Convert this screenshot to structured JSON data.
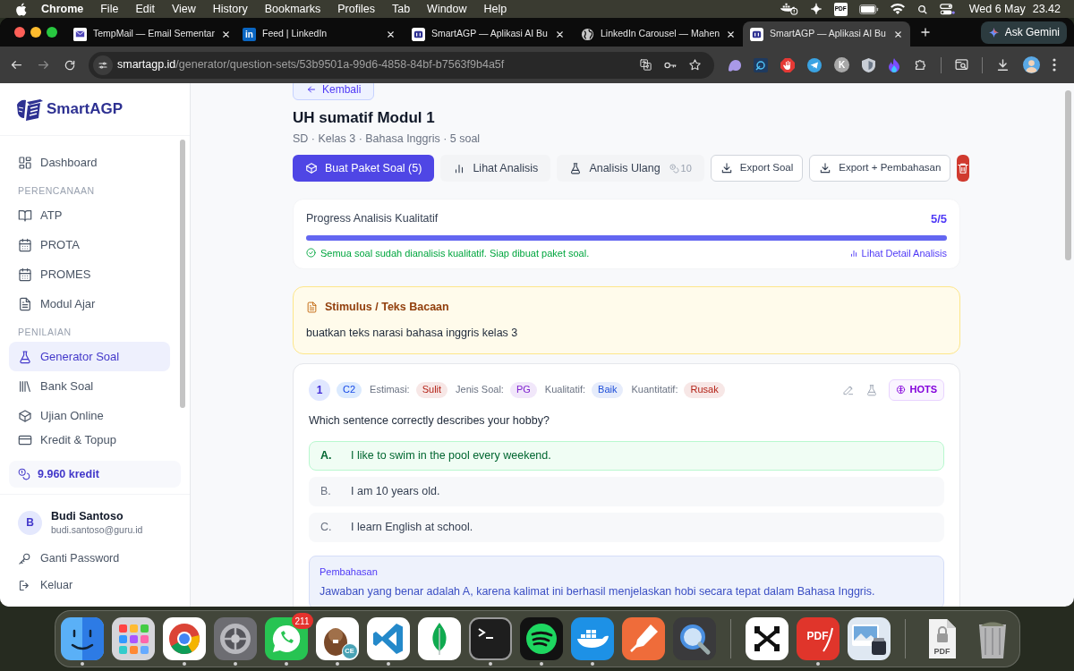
{
  "menubar": {
    "app": "Chrome",
    "menus": [
      "File",
      "Edit",
      "View",
      "History",
      "Bookmarks",
      "Profiles",
      "Tab",
      "Window",
      "Help"
    ],
    "pdf_icon_label": "PDF",
    "date": "Wed 6 May",
    "time": "23.42"
  },
  "browser": {
    "tabs": [
      {
        "title": "TempMail — Email Sementar",
        "selected": false
      },
      {
        "title": "Feed | LinkedIn",
        "selected": false,
        "favicon_label": "in"
      },
      {
        "title": "SmartAGP — Aplikasi AI Bu",
        "selected": false
      },
      {
        "title": "LinkedIn Carousel — Mahen",
        "selected": false
      },
      {
        "title": "SmartAGP — Aplikasi AI Bu",
        "selected": true
      }
    ],
    "gemini_button": "Ask Gemini",
    "url_host": "smartagp.id",
    "url_path": "/generator/question-sets/53b9501a-99d6-4858-84bf-b7563f9b4a5f",
    "extension_letter": "K"
  },
  "sidebar": {
    "brand": "SmartAGP",
    "items": [
      {
        "kind": "link",
        "label": "Dashboard",
        "selected": false
      },
      {
        "kind": "section",
        "label": "PERENCANAAN"
      },
      {
        "kind": "link",
        "label": "ATP",
        "selected": false
      },
      {
        "kind": "link",
        "label": "PROTA",
        "selected": false
      },
      {
        "kind": "link",
        "label": "PROMES",
        "selected": false
      },
      {
        "kind": "link",
        "label": "Modul Ajar",
        "selected": false
      },
      {
        "kind": "section",
        "label": "PENILAIAN"
      },
      {
        "kind": "link",
        "label": "Generator Soal",
        "selected": true
      },
      {
        "kind": "link",
        "label": "Bank Soal",
        "selected": false
      },
      {
        "kind": "link",
        "label": "Ujian Online",
        "selected": false
      }
    ],
    "pinned_item": {
      "label": "Kredit & Topup",
      "selected": false
    },
    "credits": "9.960 kredit",
    "user": {
      "initial": "B",
      "name": "Budi Santoso",
      "email": "budi.santoso@guru.id"
    },
    "account_links": [
      "Ganti Password",
      "Keluar"
    ]
  },
  "header": {
    "back": "Kembali",
    "title": "UH sumatif Modul 1",
    "subtitle": "SD · Kelas 3 · Bahasa Inggris · 5 soal",
    "actions": [
      {
        "kind": "primary",
        "label": "Buat Paket Soal (5)"
      },
      {
        "kind": "soft",
        "label": "Lihat Analisis"
      },
      {
        "kind": "soft",
        "label": "Analisis Ulang",
        "cost": "10"
      },
      {
        "kind": "outline",
        "label": "Export Soal"
      },
      {
        "kind": "outline",
        "label": "Export + Pembahasan"
      },
      {
        "kind": "danger"
      }
    ]
  },
  "progress": {
    "title": "Progress Analisis Kualitatif",
    "count": "5/5",
    "level": 1,
    "message": "Semua soal sudah dianalisis kualitatif. Siap dibuat paket soal.",
    "link": "Lihat Detail Analisis"
  },
  "stimulus": {
    "title": "Stimulus / Teks Bacaan",
    "text": "buatkan teks narasi bahasa inggris kelas 3"
  },
  "question": {
    "number": "1",
    "cognitive_level": "C2",
    "tags": [
      {
        "label": "Estimasi:",
        "value": "Sulit",
        "color": "#b42318"
      },
      {
        "label": "Jenis Soal:",
        "value": "PG",
        "color": "#7e22ce"
      },
      {
        "label": "Kualitatif:",
        "value": "Baik",
        "color": "#1d4ed8"
      },
      {
        "label": "Kuantitatif:",
        "value": "Rusak",
        "color": "#b42318"
      }
    ],
    "hots": "HOTS",
    "text": "Which sentence correctly describes your hobby?",
    "options": [
      {
        "letter": "A.",
        "text": "I like to swim in the pool every weekend.",
        "correct": true
      },
      {
        "letter": "B.",
        "text": "I am 10 years old.",
        "correct": false
      },
      {
        "letter": "C.",
        "text": "I learn English at school.",
        "correct": false
      }
    ],
    "explanation": {
      "title": "Pembahasan",
      "text": "Jawaban yang benar adalah A, karena kalimat ini berhasil menjelaskan hobi secara tepat dalam Bahasa Inggris."
    }
  },
  "dock": {
    "groups": [
      [
        {
          "running": true
        },
        {
          "running": false
        },
        {
          "running": true
        },
        {
          "running": true
        },
        {
          "running": true,
          "badge": "211"
        },
        {
          "running": true,
          "label": "CE"
        },
        {
          "running": true
        },
        {
          "running": false
        },
        {
          "running": true
        },
        {
          "running": true
        },
        {
          "running": true
        },
        {
          "running": false
        },
        {
          "running": false
        }
      ],
      [
        {
          "running": false
        },
        {
          "running": true,
          "label": "PDF"
        },
        {
          "running": false
        }
      ],
      [
        {
          "running": false,
          "label": "PDF"
        },
        {
          "running": false
        }
      ]
    ]
  }
}
